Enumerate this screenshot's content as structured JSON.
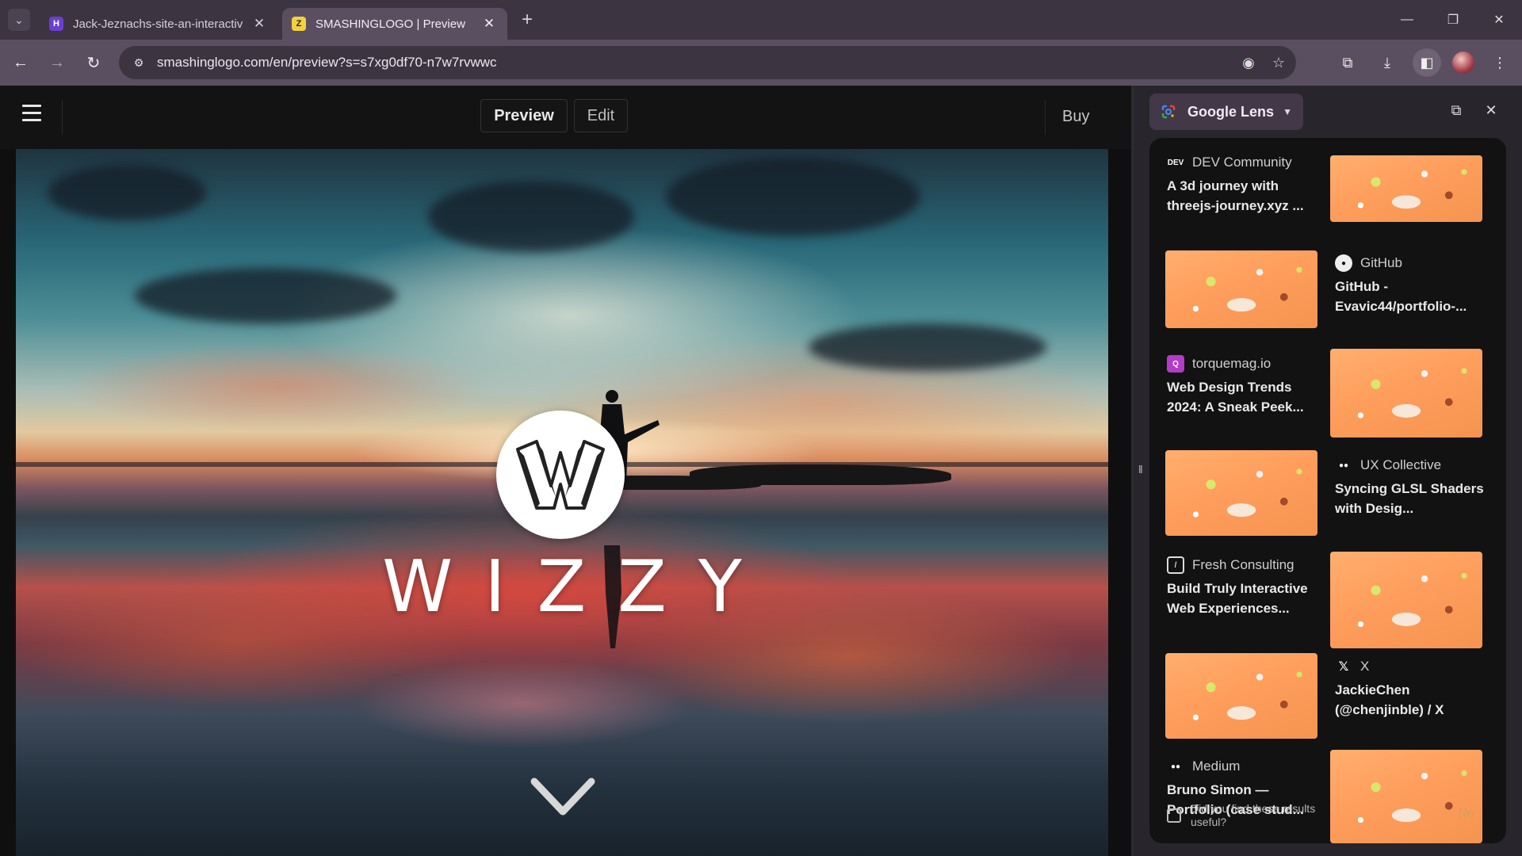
{
  "browser": {
    "tabs": [
      {
        "title": "Jack-Jeznachs-site-an-interactiv",
        "active": false
      },
      {
        "title": "SMASHINGLOGO | Preview",
        "active": true
      }
    ],
    "url": "smashinglogo.com/en/preview?s=s7xg0df70-n7w7rvwwc"
  },
  "site": {
    "preview_label": "Preview",
    "edit_label": "Edit",
    "buy_label": "Buy",
    "brand_name": "WIZZY"
  },
  "lens": {
    "title": "Google Lens",
    "results": [
      {
        "source": "DEV Community",
        "source_icon": "DEV",
        "title": "A 3d journey with threejs-journey.xyz ...",
        "thumb_side": "right"
      },
      {
        "source": "GitHub",
        "source_icon": "github-icon",
        "title": "GitHub - Evavic44/portfolio-...",
        "thumb_side": "left"
      },
      {
        "source": "torquemag.io",
        "source_icon": "torquemag-icon",
        "title": "Web Design Trends 2024: A Sneak Peek...",
        "thumb_side": "right"
      },
      {
        "source": "UX Collective",
        "source_icon": "medium-icon",
        "title": "Syncing GLSL Shaders with Desig...",
        "thumb_side": "left"
      },
      {
        "source": "Fresh Consulting",
        "source_icon": "fresh-icon",
        "title": "Build Truly Interactive Web Experiences...",
        "thumb_side": "right"
      },
      {
        "source": "X",
        "source_icon": "x-icon",
        "title": "JackieChen (@chenjinble) / X",
        "thumb_side": "left"
      },
      {
        "source": "Medium",
        "source_icon": "medium-icon",
        "title": "Bruno Simon — Portfolio (case stud...",
        "thumb_side": "right"
      }
    ],
    "feedback": {
      "question": "Did you find these results useful?",
      "no_label": "No"
    }
  },
  "colors": {
    "tab_strip": "#3c3541",
    "toolbar": "#5a4f61",
    "side_panel": "#28262c",
    "lens_thumb_orange": "#ff9e5c"
  }
}
